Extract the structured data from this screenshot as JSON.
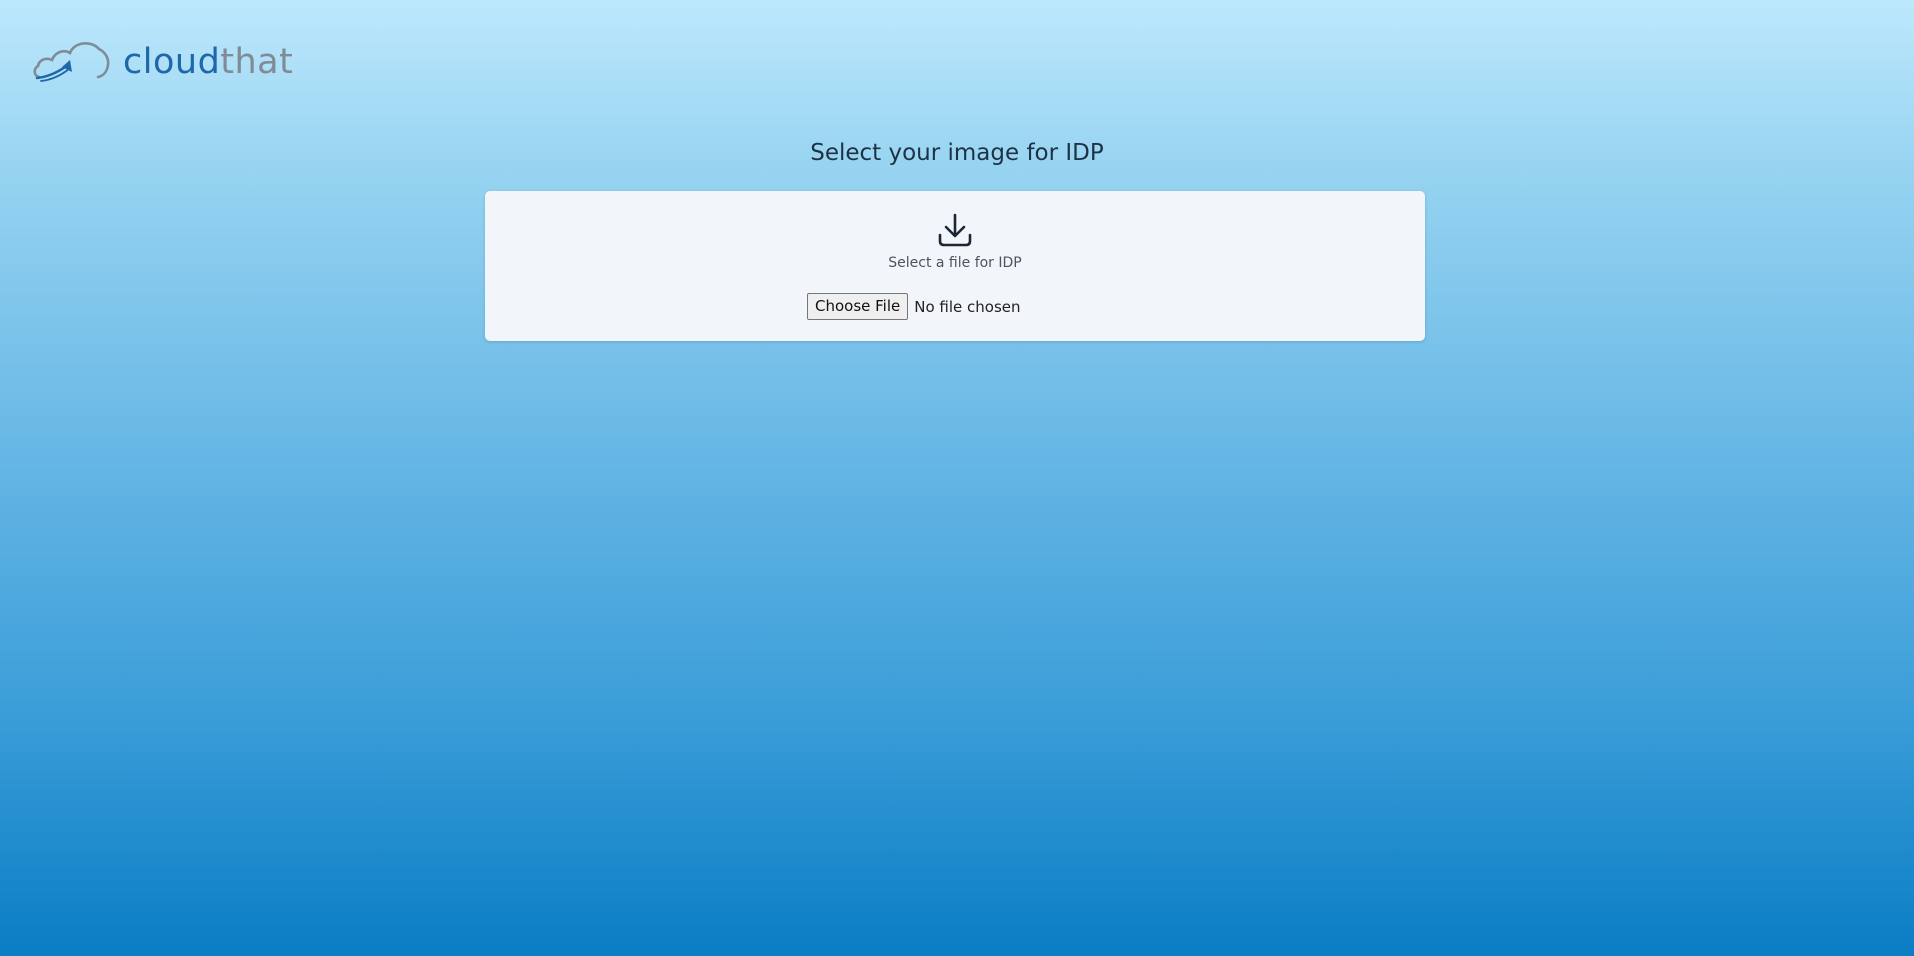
{
  "brand": {
    "logo_text_part1": "cloud",
    "logo_text_part2": "that",
    "logo_icon": "cloud-arrow-icon",
    "colors": {
      "primary": "#1e67a8",
      "secondary": "#7f8c95"
    }
  },
  "page": {
    "heading": "Select your image for IDP"
  },
  "upload": {
    "icon": "download-icon",
    "caption": "Select a file for IDP",
    "button_label": "Choose File",
    "status_text": "No file chosen"
  }
}
